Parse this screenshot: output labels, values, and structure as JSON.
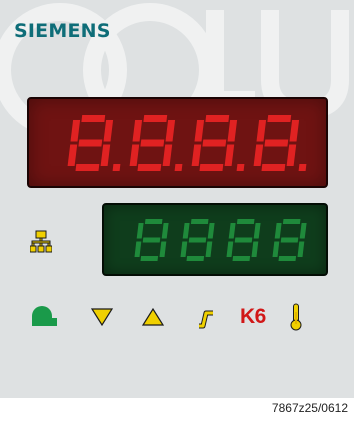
{
  "brand": {
    "name": "SIEMENS"
  },
  "main_display": {
    "digit_count": 4,
    "digit_style": "all-segments-dp",
    "segment_color": "#e02222",
    "background": "#6f1312"
  },
  "secondary_display": {
    "digit_count": 4,
    "digit_style": "all-segments",
    "segment_color": "#1f8a3b",
    "background": "#0f3d1c"
  },
  "indicators": {
    "network_icon": "network-icon",
    "status_row": [
      {
        "name": "valve-icon",
        "color": "#1a9a4a"
      },
      {
        "name": "triangle-down-icon",
        "color": "#f0d000"
      },
      {
        "name": "triangle-up-icon",
        "color": "#f0d000"
      },
      {
        "name": "step-icon",
        "color": "#f0d000"
      },
      {
        "name": "k6-label",
        "text": "K6",
        "color": "#d11717"
      },
      {
        "name": "thermometer-icon",
        "color": "#f0d000"
      }
    ]
  },
  "caption": "7867z25/0612"
}
